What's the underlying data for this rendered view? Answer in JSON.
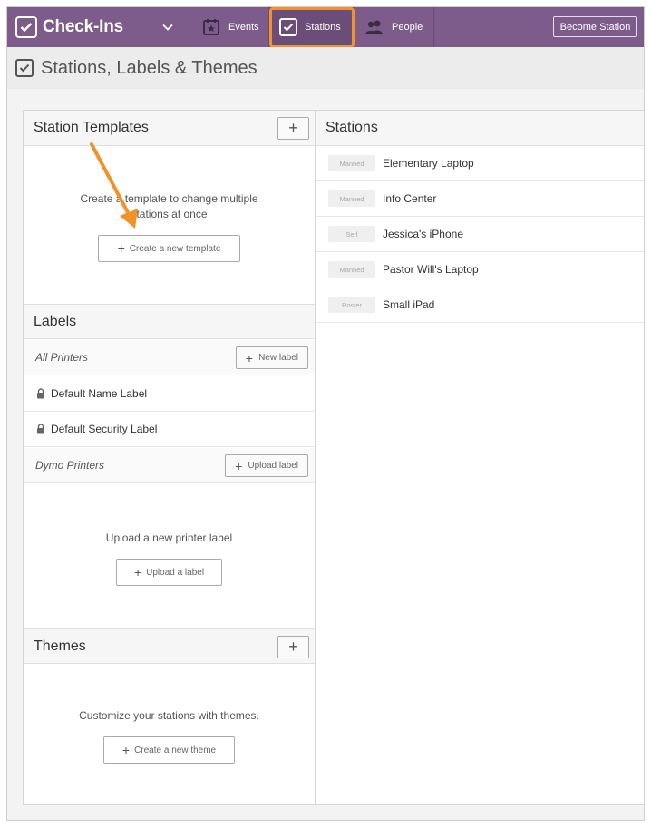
{
  "app": {
    "name": "Check-Ins",
    "nav": [
      {
        "label": "Events",
        "icon": "calendar-star-icon"
      },
      {
        "label": "Stations",
        "icon": "checkbox-icon",
        "active": true
      },
      {
        "label": "People",
        "icon": "people-icon"
      }
    ],
    "become_station_label": "Become Station",
    "accent": "#7d5c8c",
    "highlight_color": "#f0932b"
  },
  "page": {
    "title": "Stations, Labels & Themes"
  },
  "templates": {
    "title": "Station Templates",
    "add_symbol": "+",
    "empty_text_1": "Create a template to change multiple",
    "empty_text_2": "stations at once",
    "create_button": "Create a new template"
  },
  "labels": {
    "title": "Labels",
    "groups": [
      {
        "name": "All Printers",
        "button": "New label",
        "items": [
          "Default Name Label",
          "Default Security Label"
        ]
      },
      {
        "name": "Dymo Printers",
        "button": "Upload label",
        "empty_text": "Upload a new printer label",
        "empty_button": "Upload a label"
      }
    ]
  },
  "themes": {
    "title": "Themes",
    "add_symbol": "+",
    "empty_text": "Customize your stations with themes.",
    "create_button": "Create a new theme"
  },
  "stations": {
    "title": "Stations",
    "items": [
      {
        "type": "Manned",
        "name": "Elementary Laptop"
      },
      {
        "type": "Manned",
        "name": "Info Center"
      },
      {
        "type": "Self",
        "name": "Jessica's iPhone"
      },
      {
        "type": "Manned",
        "name": "Pastor Will's Laptop"
      },
      {
        "type": "Roster",
        "name": "Small iPad"
      }
    ]
  }
}
